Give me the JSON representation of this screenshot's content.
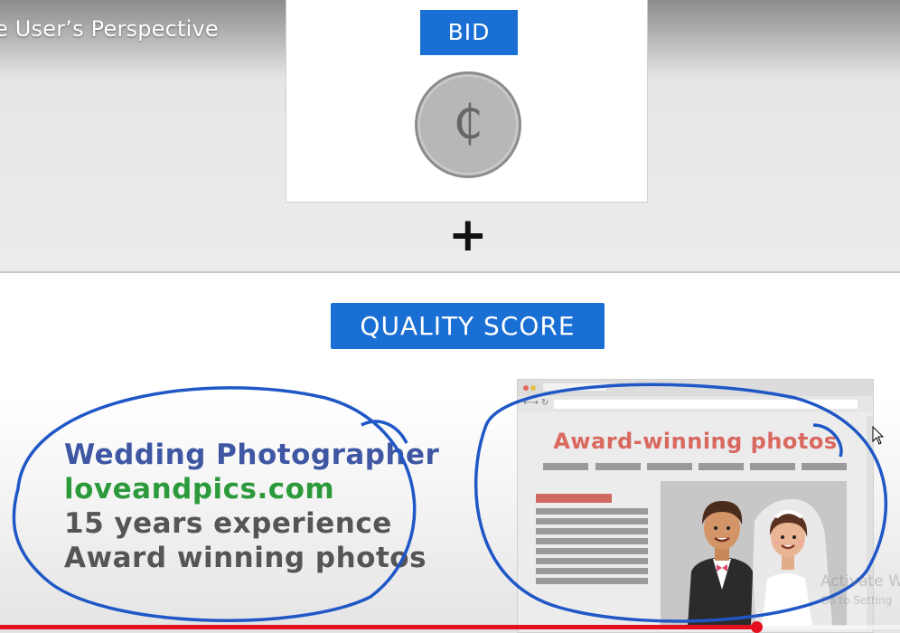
{
  "video": {
    "title": "e User’s Perspective",
    "progress": 0.84
  },
  "bid": {
    "label": "BID",
    "coin_symbol": "₵",
    "coin_icon": "cent-coin-icon"
  },
  "operator": "+",
  "quality_score": {
    "label": "QUALITY SCORE"
  },
  "ad": {
    "headline": "Wedding Photographer",
    "url": "loveandpics.com",
    "lines": [
      "15 years experience",
      "Award winning photos"
    ]
  },
  "landing_page": {
    "title": "Award-winning photos"
  },
  "watermark": {
    "line1": "Activate W",
    "line2": "Go to Setting"
  },
  "colors": {
    "accent_blue": "#1a6fd4",
    "headline_blue": "#3f57a3",
    "url_green": "#2c9a3b",
    "site_red": "#d9685f",
    "progress_red": "#e5101f"
  }
}
